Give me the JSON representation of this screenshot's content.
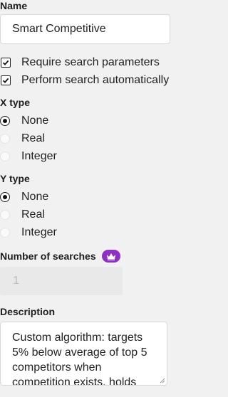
{
  "name": {
    "label": "Name",
    "value": "Smart Competitive"
  },
  "options": {
    "require_search_parameters": {
      "label": "Require search parameters",
      "checked": true
    },
    "perform_search_automatically": {
      "label": "Perform search automatically",
      "checked": true
    }
  },
  "x_type": {
    "label": "X type",
    "options": [
      "None",
      "Real",
      "Integer"
    ],
    "selected": "None"
  },
  "y_type": {
    "label": "Y type",
    "options": [
      "None",
      "Real",
      "Integer"
    ],
    "selected": "None"
  },
  "searches": {
    "label": "Number of searches",
    "badge_icon": "crown-icon",
    "badge_color": "#8e2fc6",
    "value": "1",
    "disabled": true
  },
  "description": {
    "label": "Description",
    "value": "Custom algorithm: targets 5% below average of top 5 competitors when competition exists, holds"
  }
}
